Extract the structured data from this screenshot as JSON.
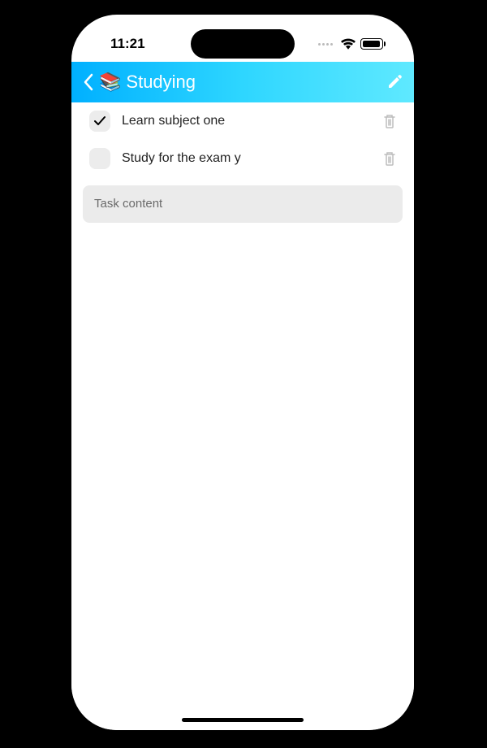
{
  "status": {
    "time": "11:21"
  },
  "topbar": {
    "title": "Studying",
    "icon": "📚"
  },
  "tasks": [
    {
      "checked": true,
      "label": "Learn subject one"
    },
    {
      "checked": false,
      "label": "Study for the exam y"
    }
  ],
  "input": {
    "placeholder": "Task content"
  }
}
